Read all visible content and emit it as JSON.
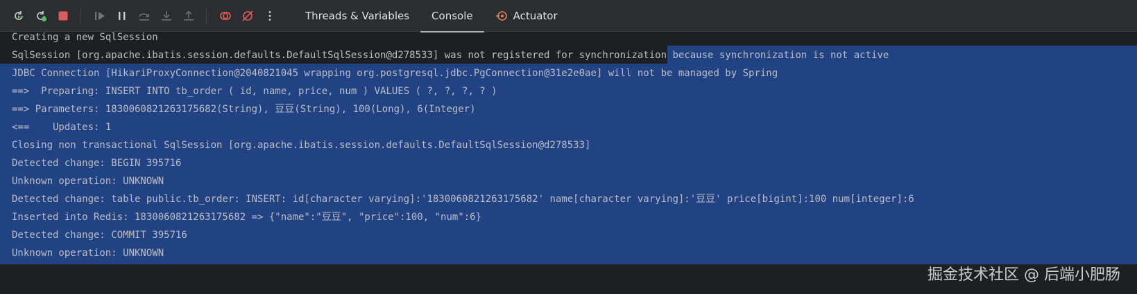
{
  "toolbar": {
    "icons": [
      "rerun-icon",
      "rerun-failed-icon",
      "stop-icon",
      "resume-icon",
      "pause-icon",
      "step-over-icon",
      "step-into-icon",
      "step-out-icon",
      "view-breakpoints-icon",
      "mute-breakpoints-icon",
      "more-icon"
    ],
    "tabs": [
      {
        "label": "Threads & Variables",
        "active": false
      },
      {
        "label": "Console",
        "active": true
      },
      {
        "label": "Actuator",
        "active": false
      }
    ]
  },
  "console": {
    "lines": [
      "Creating a new SqlSession",
      "SqlSession [org.apache.ibatis.session.defaults.DefaultSqlSession@d278533] was not registered for synchronization because synchronization is not active",
      "JDBC Connection [HikariProxyConnection@2040821045 wrapping org.postgresql.jdbc.PgConnection@31e2e0ae] will not be managed by Spring",
      "==>  Preparing: INSERT INTO tb_order ( id, name, price, num ) VALUES ( ?, ?, ?, ? )",
      "==> Parameters: 1830060821263175682(String), 豆豆(String), 100(Long), 6(Integer)",
      "<==    Updates: 1",
      "Closing non transactional SqlSession [org.apache.ibatis.session.defaults.DefaultSqlSession@d278533]",
      "Detected change: BEGIN 395716",
      "Unknown operation: UNKNOWN",
      "Detected change: table public.tb_order: INSERT: id[character varying]:'1830060821263175682' name[character varying]:'豆豆' price[bigint]:100 num[integer]:6",
      "Inserted into Redis: 1830060821263175682 => {\"name\":\"豆豆\", \"price\":100, \"num\":6}",
      "Detected change: COMMIT 395716",
      "Unknown operation: UNKNOWN"
    ]
  },
  "watermark": "掘金技术社区 @ 后端小肥肠",
  "colors": {
    "toolbar_bg": "#2b2d30",
    "console_bg": "#1e1f22",
    "selection": "#214283",
    "text": "#bcbec4",
    "rerun_green": "#5fb865",
    "stop_red": "#db5c5c",
    "breakpoint_red": "#e55d5d"
  }
}
